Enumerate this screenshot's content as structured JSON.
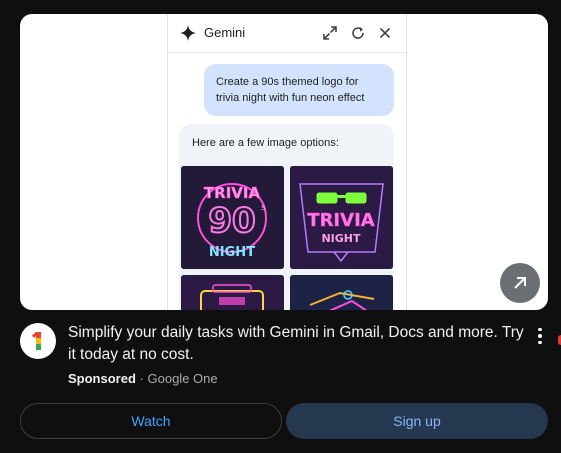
{
  "ad_preview": {
    "panel_title": "Gemini",
    "user_prompt": "Create a 90s themed logo for trivia night with fun neon effect",
    "reply_text": "Here are a few image options:",
    "images": [
      {
        "icon": "trivia-90s-night-neon-logo",
        "line1": "TRIVIA",
        "line2": "90",
        "line3": "NIGHT"
      },
      {
        "icon": "trivia-night-sunglasses-neon-logo",
        "line1": "TRIVIA",
        "line2": "NIGHT"
      },
      {
        "icon": "boombox-neon-logo"
      },
      {
        "icon": "neon-shapes-logo"
      }
    ]
  },
  "ad": {
    "title": "Simplify your daily tasks with Gemini in Gmail, Docs and more. Try it today at no cost.",
    "sponsored_label": "Sponsored",
    "separator": "·",
    "advertiser": "Google One",
    "watch_label": "Watch",
    "signup_label": "Sign up"
  },
  "colors": {
    "background": "#0f0f0f",
    "accent": "#3ea6ff",
    "signup_bg": "#263850"
  }
}
